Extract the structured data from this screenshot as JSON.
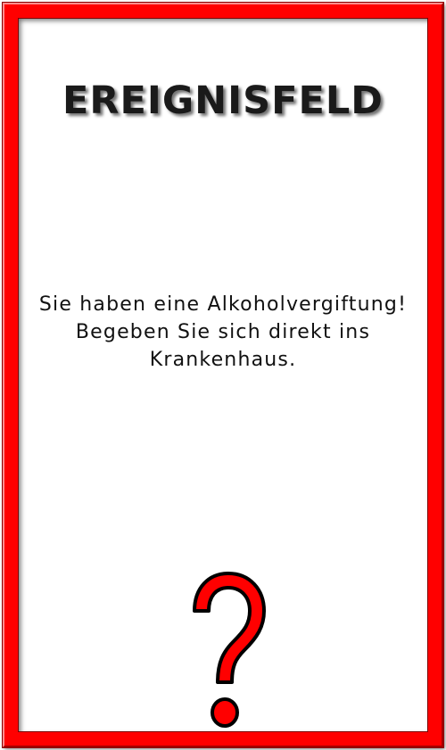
{
  "card": {
    "title": "EREIGNISFELD",
    "message_lines": [
      "Sie haben eine Alkoholvergiftung!",
      "Begeben Sie sich direkt ins",
      "Krankenhaus."
    ],
    "icon": "question-mark-icon"
  },
  "colors": {
    "frame": "#ff0000",
    "background": "#ffffff",
    "text": "#111111",
    "icon_fill": "#ff0000",
    "icon_outline": "#000000"
  }
}
